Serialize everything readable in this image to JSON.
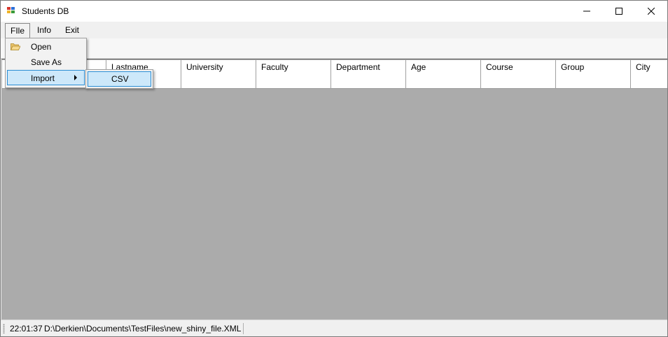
{
  "window": {
    "title": "Students DB"
  },
  "menu": {
    "file": "FIle",
    "info": "Info",
    "exit": "Exit"
  },
  "file_menu": {
    "open": "Open",
    "save_as": "Save As",
    "import": "Import",
    "import_submenu": {
      "csv": "CSV"
    }
  },
  "grid": {
    "columns": [
      "Lastname",
      "University",
      "Faculty",
      "Department",
      "Age",
      "Course",
      "Group",
      "City"
    ]
  },
  "status": {
    "time": "22:01:37",
    "path": "D:\\Derkien\\Documents\\TestFiles\\new_shiny_file.XML"
  }
}
